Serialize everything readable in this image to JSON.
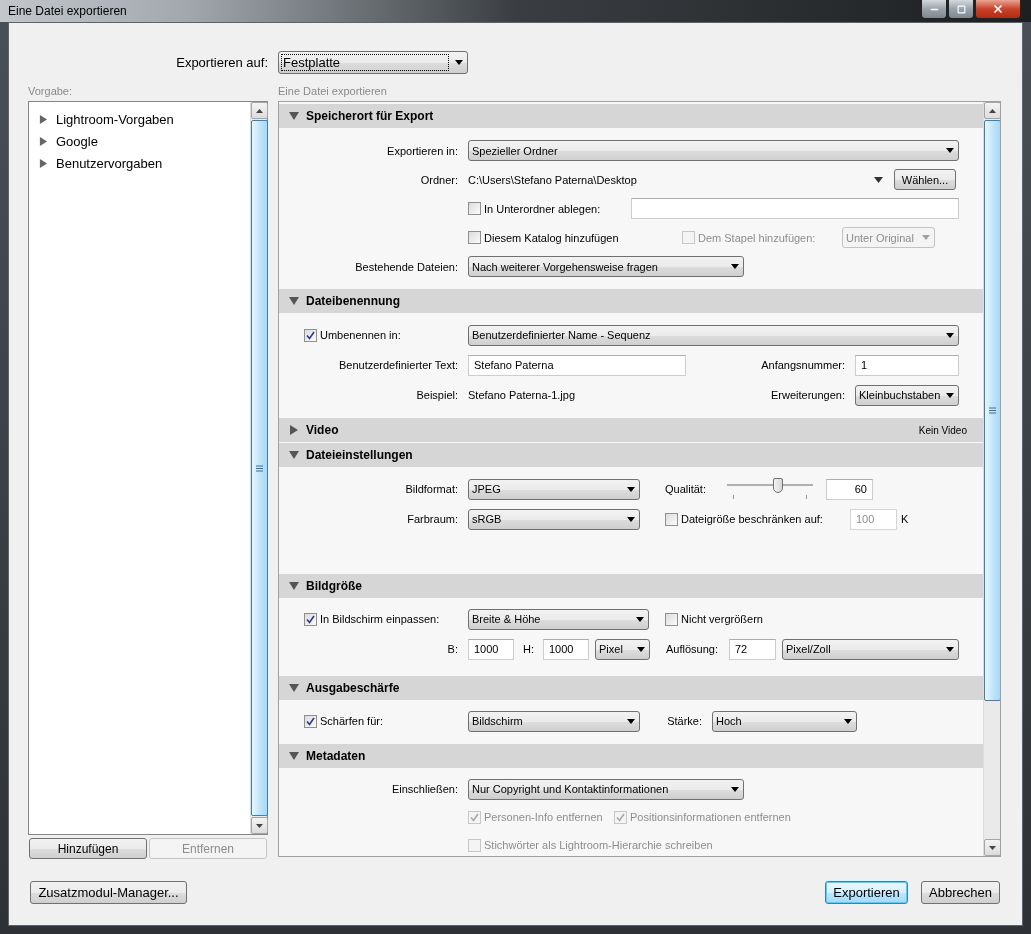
{
  "window": {
    "title": "Eine Datei exportieren"
  },
  "destination": {
    "label": "Exportieren auf:",
    "value": "Festplatte",
    "focused": true
  },
  "presets": {
    "label": "Vorgabe:",
    "items": [
      {
        "label": "Lightroom-Vorgaben",
        "expanded": false
      },
      {
        "label": "Google",
        "expanded": false
      },
      {
        "label": "Benutzervorgaben",
        "expanded": false
      }
    ],
    "buttons": [
      {
        "label": "Hinzufügen",
        "disabled": false
      },
      {
        "label": "Entfernen",
        "disabled": true
      }
    ]
  },
  "settings": {
    "label": "Eine Datei exportieren",
    "sections": [
      {
        "title": "Speicherort für Export",
        "expanded": true,
        "rows": [
          {
            "items": [
              {
                "kind": "label",
                "text": "Exportieren in:"
              },
              {
                "kind": "select",
                "value": "Spezieller Ordner",
                "disabled": false
              }
            ]
          },
          {
            "items": [
              {
                "kind": "label",
                "text": "Ordner:"
              },
              {
                "kind": "text",
                "text": "C:\\Users\\Stefano Paterna\\Desktop"
              },
              {
                "kind": "menu_caret"
              },
              {
                "kind": "button",
                "label": "Wählen..."
              }
            ]
          },
          {
            "items": [
              {
                "kind": "checkbox",
                "label": "In Unterordner ablegen:",
                "checked": false,
                "disabled": false
              },
              {
                "kind": "input",
                "disabled": false
              }
            ]
          },
          {
            "items": [
              {
                "kind": "checkbox",
                "label": "Diesem Katalog hinzufügen",
                "checked": false,
                "disabled": false
              },
              {
                "kind": "checkbox",
                "label": "Dem Stapel hinzufügen:",
                "checked": false,
                "disabled": true
              },
              {
                "kind": "select",
                "value": "Unter Original",
                "disabled": true
              }
            ]
          },
          {
            "items": [
              {
                "kind": "label",
                "text": "Bestehende Dateien:"
              },
              {
                "kind": "select",
                "value": "Nach weiterer Vorgehensweise fragen",
                "disabled": false
              }
            ]
          }
        ]
      },
      {
        "title": "Dateibenennung",
        "expanded": true,
        "rows": [
          {
            "items": [
              {
                "kind": "checkbox",
                "label": "Umbenennen in:",
                "checked": true,
                "disabled": false
              },
              {
                "kind": "select",
                "value": "Benutzerdefinierter Name - Sequenz",
                "disabled": false
              }
            ]
          },
          {
            "items": [
              {
                "kind": "label",
                "text": "Benutzerdefinierter Text:"
              },
              {
                "kind": "input",
                "value": "Stefano Paterna",
                "disabled": false
              },
              {
                "kind": "label",
                "text": "Anfangsnummer:"
              },
              {
                "kind": "input",
                "value": "1",
                "disabled": false
              }
            ]
          },
          {
            "items": [
              {
                "kind": "label",
                "text": "Beispiel:"
              },
              {
                "kind": "text",
                "text": "Stefano Paterna-1.jpg"
              },
              {
                "kind": "label",
                "text": "Erweiterungen:"
              },
              {
                "kind": "select",
                "value": "Kleinbuchstaben",
                "disabled": false
              }
            ]
          }
        ]
      },
      {
        "title": "Video",
        "expanded": false,
        "note": "Kein Video"
      },
      {
        "title": "Dateieinstellungen",
        "expanded": true,
        "rows": [
          {
            "items": [
              {
                "kind": "label",
                "text": "Bildformat:"
              },
              {
                "kind": "select",
                "value": "JPEG",
                "disabled": false
              },
              {
                "kind": "label",
                "text": "Qualität:"
              },
              {
                "kind": "slider",
                "level": 0.6
              },
              {
                "kind": "input",
                "value": "60",
                "disabled": false
              }
            ]
          },
          {
            "items": [
              {
                "kind": "label",
                "text": "Farbraum:"
              },
              {
                "kind": "select",
                "value": "sRGB",
                "disabled": false
              },
              {
                "kind": "checkbox",
                "label": "Dateigröße beschränken auf:",
                "checked": false,
                "disabled": false
              },
              {
                "kind": "input",
                "value": "100",
                "disabled": true
              },
              {
                "kind": "text",
                "text": "K"
              }
            ]
          }
        ]
      },
      {
        "title": "Bildgröße",
        "expanded": true,
        "rows": [
          {
            "items": [
              {
                "kind": "checkbox",
                "label": "In Bildschirm einpassen:",
                "checked": true,
                "disabled": false
              },
              {
                "kind": "select",
                "value": "Breite & Höhe",
                "disabled": false
              },
              {
                "kind": "checkbox",
                "label": "Nicht vergrößern",
                "checked": false,
                "disabled": false
              }
            ]
          },
          {
            "items": [
              {
                "kind": "label",
                "text": "B:"
              },
              {
                "kind": "input",
                "value": "1000",
                "disabled": false
              },
              {
                "kind": "label",
                "text": "H:"
              },
              {
                "kind": "input",
                "value": "1000",
                "disabled": false
              },
              {
                "kind": "select",
                "value": "Pixel",
                "disabled": false
              },
              {
                "kind": "label",
                "text": "Auflösung:"
              },
              {
                "kind": "input",
                "value": "72",
                "disabled": false
              },
              {
                "kind": "select",
                "value": "Pixel/Zoll",
                "disabled": false
              }
            ]
          }
        ]
      },
      {
        "title": "Ausgabeschärfe",
        "expanded": true,
        "rows": [
          {
            "items": [
              {
                "kind": "checkbox",
                "label": "Schärfen für:",
                "checked": true,
                "disabled": false
              },
              {
                "kind": "select",
                "value": "Bildschirm",
                "disabled": false
              },
              {
                "kind": "label",
                "text": "Stärke:"
              },
              {
                "kind": "select",
                "value": "Hoch",
                "disabled": false
              }
            ]
          }
        ]
      },
      {
        "title": "Metadaten",
        "expanded": true,
        "rows": [
          {
            "items": [
              {
                "kind": "label",
                "text": "Einschließen:"
              },
              {
                "kind": "select",
                "value": "Nur Copyright und Kontaktinformationen",
                "disabled": false
              }
            ]
          },
          {
            "items": [
              {
                "kind": "checkbox",
                "label": "Personen-Info entfernen",
                "checked": true,
                "disabled": true
              },
              {
                "kind": "checkbox",
                "label": "Positionsinformationen entfernen",
                "checked": true,
                "disabled": true
              }
            ]
          },
          {
            "items": [
              {
                "kind": "checkbox",
                "label": "Stichwörter als Lightroom-Hierarchie schreiben",
                "checked": false,
                "disabled": true
              }
            ]
          }
        ]
      }
    ]
  },
  "footer": {
    "manager_button": {
      "label": "Zusatzmodul-Manager..."
    },
    "buttons": [
      {
        "label": "Exportieren",
        "default": true
      },
      {
        "label": "Abbrechen",
        "default": false
      }
    ]
  }
}
